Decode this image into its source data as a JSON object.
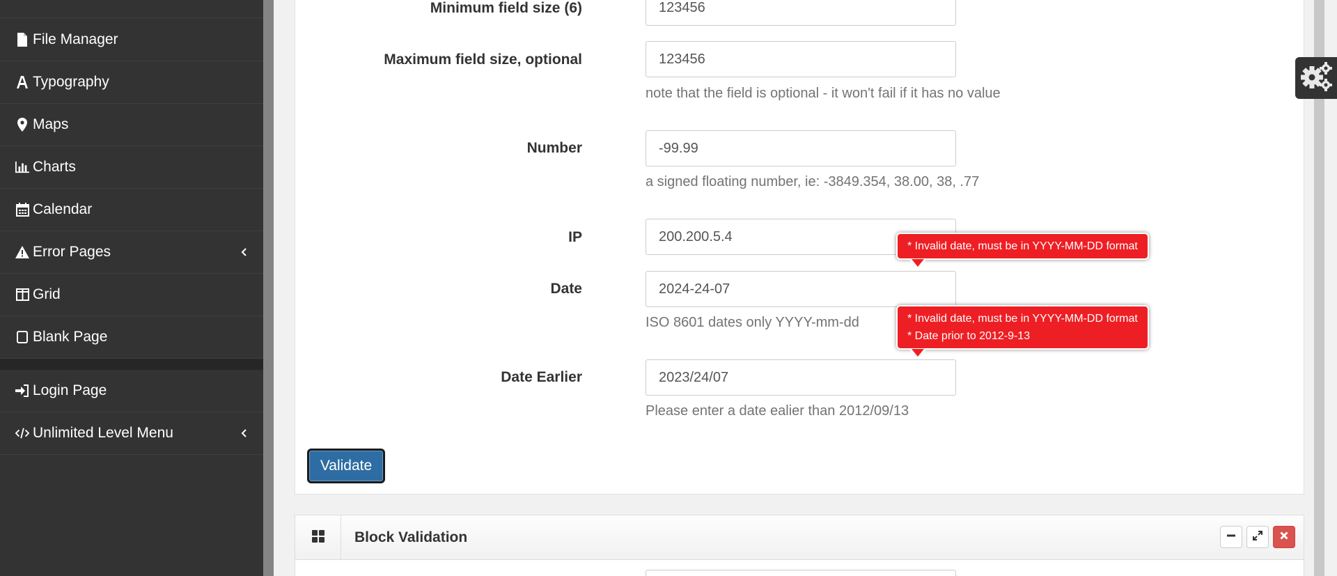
{
  "sidebar": {
    "items": [
      {
        "label": "File Manager",
        "icon": "file-icon"
      },
      {
        "label": "Typography",
        "icon": "font-icon"
      },
      {
        "label": "Maps",
        "icon": "map-marker-icon"
      },
      {
        "label": "Charts",
        "icon": "bar-chart-icon"
      },
      {
        "label": "Calendar",
        "icon": "calendar-icon"
      },
      {
        "label": "Error Pages",
        "icon": "warning-icon",
        "has_submenu": true
      },
      {
        "label": "Grid",
        "icon": "columns-icon"
      },
      {
        "label": "Blank Page",
        "icon": "square-icon"
      }
    ],
    "items2": [
      {
        "label": "Login Page",
        "icon": "sign-in-icon"
      },
      {
        "label": "Unlimited Level Menu",
        "icon": "code-icon",
        "has_submenu": true
      }
    ]
  },
  "form": {
    "min_size": {
      "label": "Minimum field size (6)",
      "value": "123456"
    },
    "max_size": {
      "label": "Maximum field size, optional",
      "value": "123456",
      "help": "note that the field is optional - it won't fail if it has no value"
    },
    "number": {
      "label": "Number",
      "value": "-99.99",
      "help": "a signed floating number, ie: -3849.354, 38.00, 38, .77"
    },
    "ip": {
      "label": "IP",
      "value": "200.200.5.4"
    },
    "date": {
      "label": "Date",
      "value": "2024-24-07",
      "help": "ISO 8601 dates only YYYY-mm-dd"
    },
    "date_earlier": {
      "label": "Date Earlier",
      "value": "2023/24/07",
      "help": "Please enter a date ealier than 2012/09/13"
    },
    "validate_label": "Validate"
  },
  "errors": {
    "date": [
      "* Invalid date, must be in YYYY-MM-DD format"
    ],
    "date_earlier": [
      "* Invalid date, must be in YYYY-MM-DD format",
      "* Date prior to 2012-9-13"
    ]
  },
  "block": {
    "title": "Block Validation"
  },
  "colors": {
    "sidebar_bg": "#333333",
    "error_bg": "#ee1f24",
    "primary": "#2e6da4",
    "close_btn": "#d9534f"
  }
}
